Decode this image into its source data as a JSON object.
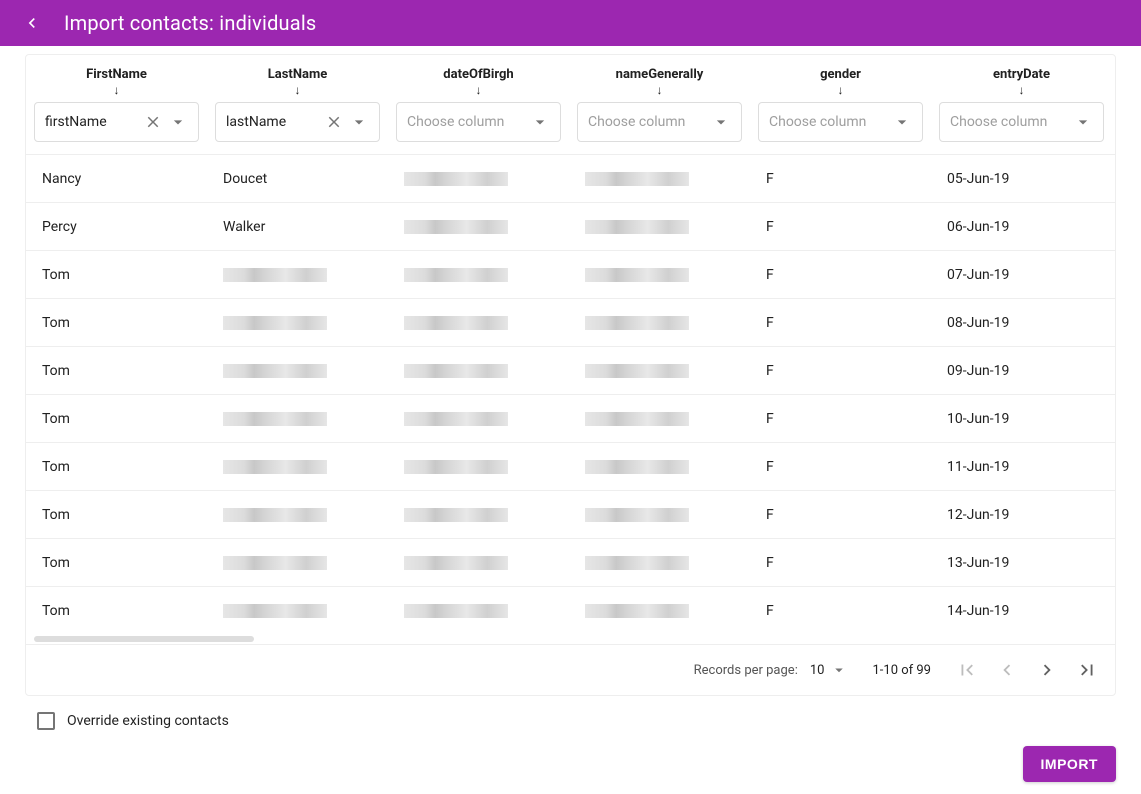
{
  "header": {
    "title": "Import contacts: individuals"
  },
  "columns": [
    {
      "label": "FirstName",
      "selected": "firstName",
      "placeholder": "Choose column",
      "hasValue": true
    },
    {
      "label": "LastName",
      "selected": "lastName",
      "placeholder": "Choose column",
      "hasValue": true
    },
    {
      "label": "dateOfBirgh",
      "selected": "",
      "placeholder": "Choose column",
      "hasValue": false
    },
    {
      "label": "nameGenerally",
      "selected": "",
      "placeholder": "Choose column",
      "hasValue": false
    },
    {
      "label": "gender",
      "selected": "",
      "placeholder": "Choose column",
      "hasValue": false
    },
    {
      "label": "entryDate",
      "selected": "",
      "placeholder": "Choose column",
      "hasValue": false
    }
  ],
  "rows": [
    {
      "firstName": "Nancy",
      "lastName": "Doucet",
      "dob_blur": true,
      "name_blur": true,
      "gender": "F",
      "entryDate": "05-Jun-19",
      "ln_blur": false
    },
    {
      "firstName": "Percy",
      "lastName": "Walker",
      "dob_blur": true,
      "name_blur": true,
      "gender": "F",
      "entryDate": "06-Jun-19",
      "ln_blur": false
    },
    {
      "firstName": "Tom",
      "lastName": "",
      "dob_blur": true,
      "name_blur": true,
      "gender": "F",
      "entryDate": "07-Jun-19",
      "ln_blur": true
    },
    {
      "firstName": "Tom",
      "lastName": "",
      "dob_blur": true,
      "name_blur": true,
      "gender": "F",
      "entryDate": "08-Jun-19",
      "ln_blur": true
    },
    {
      "firstName": "Tom",
      "lastName": "",
      "dob_blur": true,
      "name_blur": true,
      "gender": "F",
      "entryDate": "09-Jun-19",
      "ln_blur": true
    },
    {
      "firstName": "Tom",
      "lastName": "",
      "dob_blur": true,
      "name_blur": true,
      "gender": "F",
      "entryDate": "10-Jun-19",
      "ln_blur": true
    },
    {
      "firstName": "Tom",
      "lastName": "",
      "dob_blur": true,
      "name_blur": true,
      "gender": "F",
      "entryDate": "11-Jun-19",
      "ln_blur": true
    },
    {
      "firstName": "Tom",
      "lastName": "",
      "dob_blur": true,
      "name_blur": true,
      "gender": "F",
      "entryDate": "12-Jun-19",
      "ln_blur": true
    },
    {
      "firstName": "Tom",
      "lastName": "",
      "dob_blur": true,
      "name_blur": true,
      "gender": "F",
      "entryDate": "13-Jun-19",
      "ln_blur": true
    },
    {
      "firstName": "Tom",
      "lastName": "",
      "dob_blur": true,
      "name_blur": true,
      "gender": "F",
      "entryDate": "14-Jun-19",
      "ln_blur": true
    }
  ],
  "pagination": {
    "recordsPerPageLabel": "Records per page:",
    "recordsPerPage": "10",
    "rangeText": "1-10 of 99"
  },
  "override": {
    "label": "Override existing contacts",
    "checked": false
  },
  "actions": {
    "importLabel": "IMPORT"
  }
}
